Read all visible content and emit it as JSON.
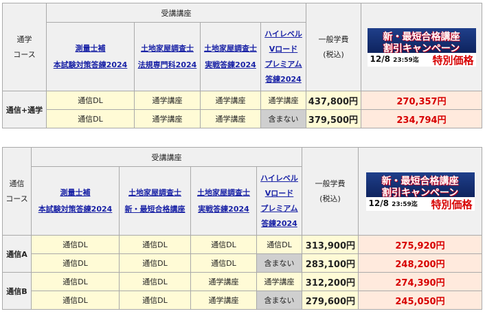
{
  "banner": {
    "line1": "新・最短合格講座",
    "line2": "割引キャンペーン",
    "date": "12/8",
    "time": "23:59迄",
    "price_label": "特別価格"
  },
  "table1": {
    "course_header": "通学\nコース",
    "courses_header": "受講講座",
    "course_links": [
      "測量士補\n本試験対策答練2024",
      "土地家屋調査士\n法規専門科2024",
      "土地家屋調査士\n実戦答練2024",
      "ハイレベル\nVロード\nプレミアム\n答練2024"
    ],
    "fee_header": "一般学費\n(税込)",
    "row_label": "通信+通学",
    "rows": [
      {
        "c1": "通信DL",
        "c2": "通学講座",
        "c3": "通学講座",
        "c4": "通学講座",
        "fee": "437,800円",
        "sale": "270,357円"
      },
      {
        "c1": "通信DL",
        "c2": "通学講座",
        "c3": "通学講座",
        "c4": "含まない",
        "fee": "379,500円",
        "sale": "234,794円"
      }
    ]
  },
  "table2": {
    "course_header": "通信\nコース",
    "courses_header": "受講講座",
    "course_links": [
      "測量士補\n本試験対策答練2024",
      "土地家屋調査士\n新・最短合格講座",
      "土地家屋調査士\n実戦答練2024",
      "ハイレベル\nVロード\nプレミアム\n答練2024"
    ],
    "fee_header": "一般学費\n(税込)",
    "groups": [
      {
        "label": "通信A",
        "rows": [
          {
            "c1": "通信DL",
            "c2": "通信DL",
            "c3": "通信DL",
            "c4": "通信DL",
            "fee": "313,900円",
            "sale": "275,920円"
          },
          {
            "c1": "通信DL",
            "c2": "通信DL",
            "c3": "通信DL",
            "c4": "含まない",
            "fee": "283,100円",
            "sale": "248,200円"
          }
        ]
      },
      {
        "label": "通信B",
        "rows": [
          {
            "c1": "通信DL",
            "c2": "通信DL",
            "c3": "通学講座",
            "c4": "通学講座",
            "fee": "312,200円",
            "sale": "274,390円"
          },
          {
            "c1": "通信DL",
            "c2": "通信DL",
            "c3": "通学講座",
            "c4": "含まない",
            "fee": "279,600円",
            "sale": "245,050円"
          }
        ]
      }
    ]
  }
}
